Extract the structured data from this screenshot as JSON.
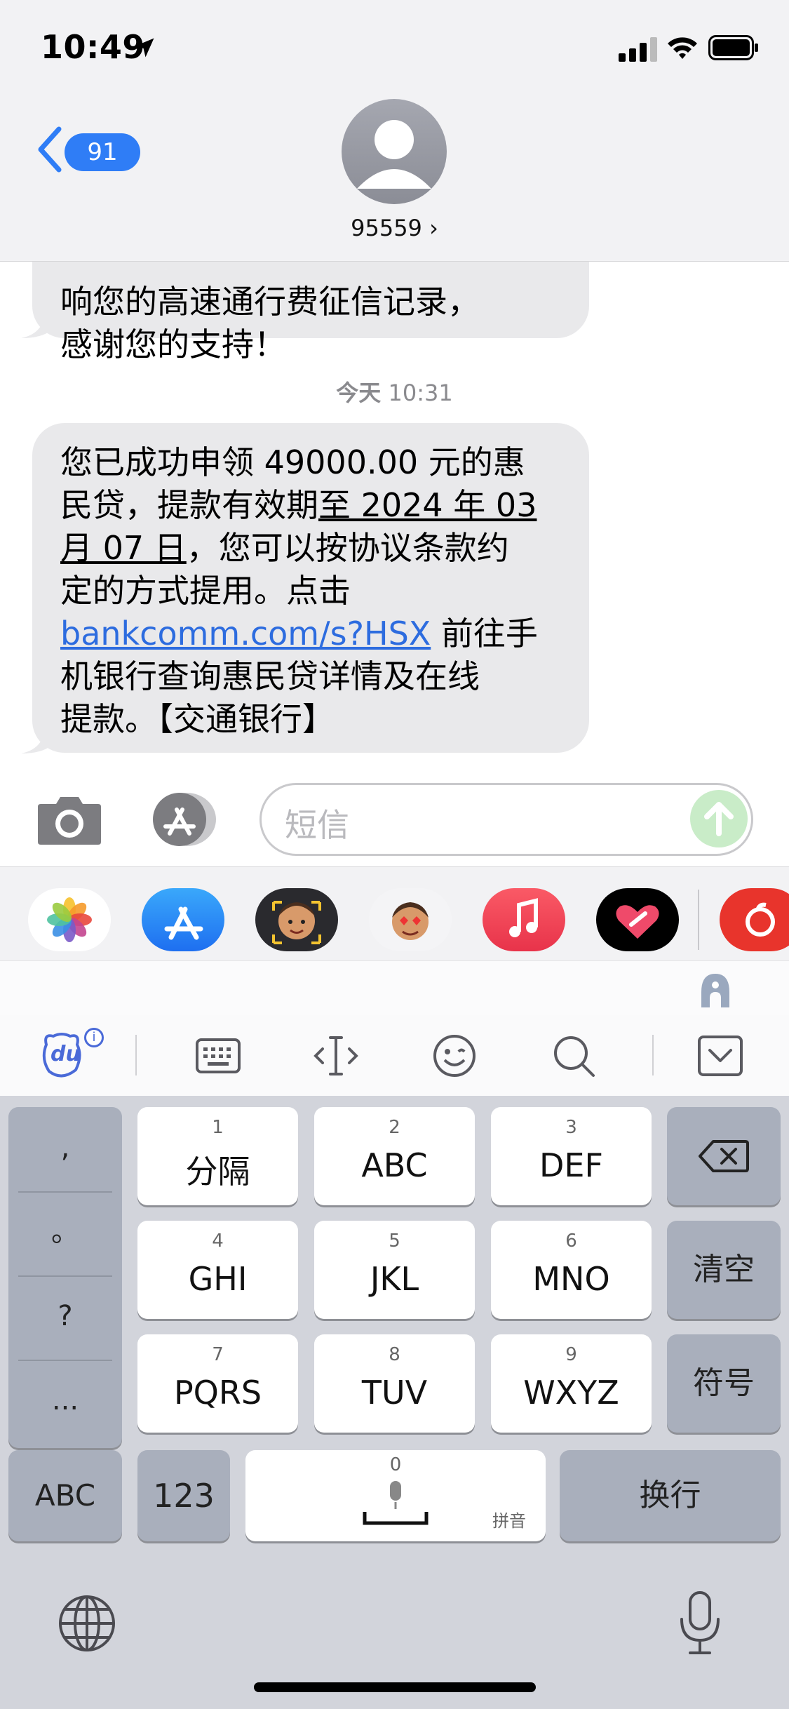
{
  "status_bar": {
    "time": "10:49"
  },
  "nav": {
    "back_badge": "91",
    "contact": "95559 ›"
  },
  "messages": {
    "prev_partial_line1": "响您的高速通行费征信记录，",
    "prev_partial_line2": "感谢您的支持！",
    "timestamp_day": "今天",
    "timestamp_time": "10:31",
    "msg_line1": "您已成功申领 49000.00 元的惠",
    "msg_line2_a": "民贷，提款有效期",
    "msg_line2_b": "至 2024 年 03",
    "msg_line3_a": "月 07 日",
    "msg_line3_b": "，您可以按协议条款约",
    "msg_line4": "定的方式提用。点击",
    "msg_link": "bankcomm.com/s?HSX",
    "msg_line5_b": " 前往手",
    "msg_line6": "机银行查询惠民贷详情及在线",
    "msg_line7": "提款。【交通银行】"
  },
  "composer": {
    "placeholder": "短信"
  },
  "keyboard": {
    "punct": [
      ",",
      "。",
      "?",
      "..."
    ],
    "keys": {
      "k1": {
        "num": "1",
        "label": "分隔"
      },
      "k2": {
        "num": "2",
        "label": "ABC"
      },
      "k3": {
        "num": "3",
        "label": "DEF"
      },
      "k4": {
        "num": "4",
        "label": "GHI"
      },
      "k5": {
        "num": "5",
        "label": "JKL"
      },
      "k6": {
        "num": "6",
        "label": "MNO"
      },
      "k7": {
        "num": "7",
        "label": "PQRS"
      },
      "k8": {
        "num": "8",
        "label": "TUV"
      },
      "k9": {
        "num": "9",
        "label": "WXYZ"
      },
      "k0": {
        "num": "0",
        "label": "拼音"
      }
    },
    "clear": "清空",
    "symbols": "符号",
    "abc": "ABC",
    "num123": "123",
    "enter": "换行"
  },
  "toolbar": {
    "brand": "du",
    "info": "i"
  },
  "colors": {
    "link": "#2d6cdf",
    "badge": "#2f7df6",
    "send": "#c9ecc8"
  }
}
